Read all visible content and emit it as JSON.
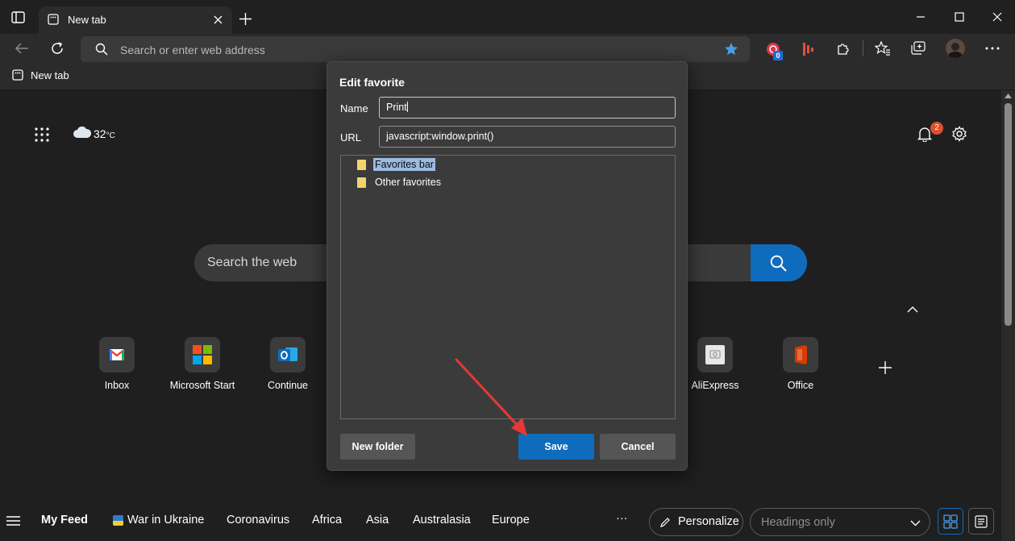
{
  "browser": {
    "tab_title": "New tab",
    "address_placeholder": "Search or enter web address",
    "extension_badge": "0",
    "favorites_bar_item": "New tab"
  },
  "newtab": {
    "weather_temp": "32",
    "weather_unit": "°C",
    "notifications_count": "2",
    "search_placeholder": "Search the web",
    "quick_links": [
      {
        "label": "Inbox"
      },
      {
        "label": "Microsoft Start"
      },
      {
        "label": "Continue"
      },
      {
        "label": "AliExpress"
      },
      {
        "label": "Office"
      }
    ]
  },
  "feed": {
    "my_feed": "My Feed",
    "items": [
      "War in Ukraine",
      "Coronavirus",
      "Africa",
      "Asia",
      "Australasia",
      "Europe"
    ],
    "more": "···",
    "personalize": "Personalize",
    "layout_select": "Headings only"
  },
  "dialog": {
    "title": "Edit favorite",
    "name_label": "Name",
    "name_value": "Print",
    "url_label": "URL",
    "url_value": "javascript:window.print()",
    "folders": [
      "Favorites bar",
      "Other favorites"
    ],
    "new_folder": "New folder",
    "save": "Save",
    "cancel": "Cancel"
  },
  "colors": {
    "accent": "#0f6cbd",
    "badge": "#e04f2c",
    "arrow": "#e53935"
  }
}
